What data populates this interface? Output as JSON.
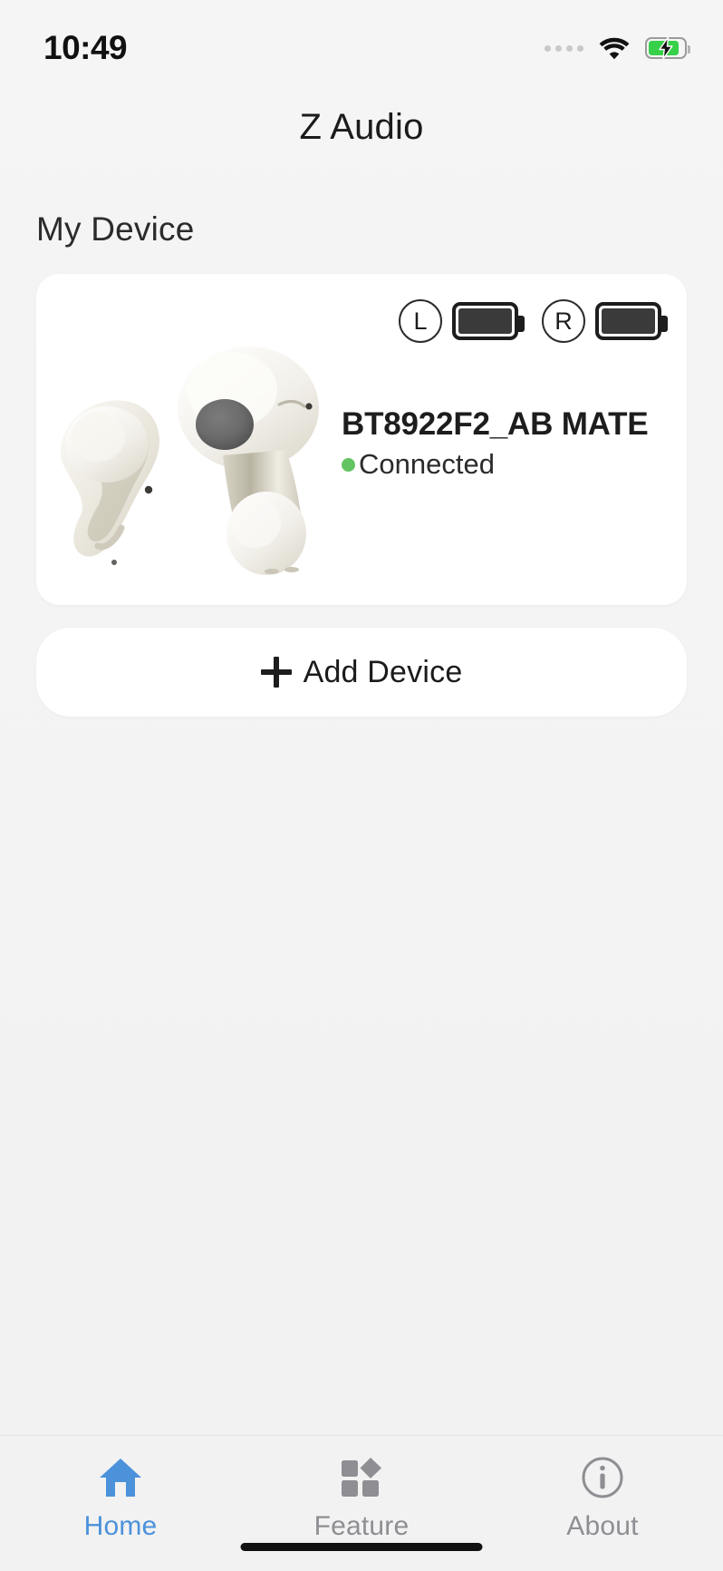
{
  "status_bar": {
    "time": "10:49",
    "signal_icon": "signal-dots-icon",
    "wifi_icon": "wifi-icon",
    "battery_icon": "battery-charging-icon",
    "battery_charging": true,
    "battery_color": "#37d049"
  },
  "header": {
    "title": "Z Audio"
  },
  "main": {
    "section_title": "My Device",
    "device": {
      "name": "BT8922F2_AB MATE",
      "status": "Connected",
      "status_color": "#62c462",
      "product_image": "earbuds-photo",
      "batteries": [
        {
          "side_label": "L",
          "level": 100,
          "icon": "battery-icon"
        },
        {
          "side_label": "R",
          "level": 100,
          "icon": "battery-icon"
        }
      ]
    },
    "add_device": {
      "label": "Add Device",
      "icon": "plus-icon"
    }
  },
  "tabbar": {
    "active": "Home",
    "items": [
      {
        "label": "Home",
        "icon": "home-icon",
        "active": true,
        "color": "#4b92db"
      },
      {
        "label": "Feature",
        "icon": "grid-shapes-icon",
        "active": false,
        "color": "#8e8e93"
      },
      {
        "label": "About",
        "icon": "info-circle-icon",
        "active": false,
        "color": "#8e8e93"
      }
    ]
  }
}
